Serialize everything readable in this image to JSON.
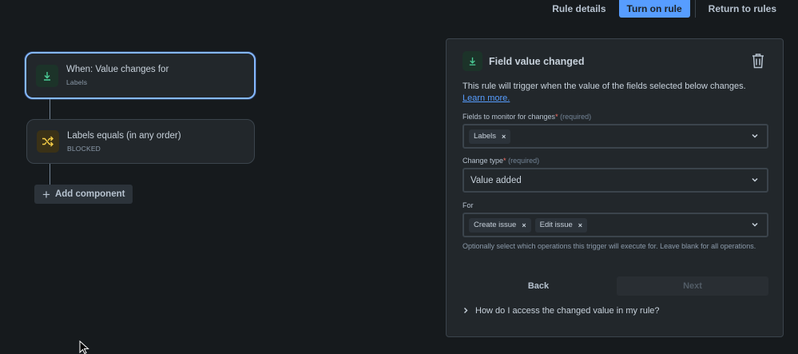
{
  "topbar": {
    "rule_details": "Rule details",
    "turn_on": "Turn on rule",
    "return": "Return to rules"
  },
  "flow": {
    "trigger": {
      "title": "When: Value changes for",
      "subtitle": "Labels",
      "icon": "download-arrow-icon"
    },
    "condition": {
      "title": "Labels equals (in any order)",
      "subtitle": "BLOCKED",
      "icon": "shuffle-icon"
    },
    "add_component": "Add component"
  },
  "panel": {
    "title": "Field value changed",
    "description": "This rule will trigger when the value of the fields selected below changes.",
    "learn_more": "Learn more.",
    "fields_label": "Fields to monitor for changes",
    "fields_required": "(required)",
    "fields_tags": [
      "Labels"
    ],
    "change_type_label": "Change type",
    "change_type_required": "(required)",
    "change_type_value": "Value added",
    "for_label": "For",
    "for_tags": [
      "Create issue",
      "Edit issue"
    ],
    "help_text": "Optionally select which operations this trigger will execute for. Leave blank for all operations.",
    "back": "Back",
    "next": "Next",
    "faq": "How do I access the changed value in my rule?",
    "required_star": "*",
    "tag_remove": "×"
  },
  "colors": {
    "background": "#161a1d",
    "panel": "#22272b",
    "primary": "#579dff",
    "selected_border": "#85b8ff",
    "trigger_icon": "#4bce97",
    "condition_icon": "#f5cd47"
  }
}
